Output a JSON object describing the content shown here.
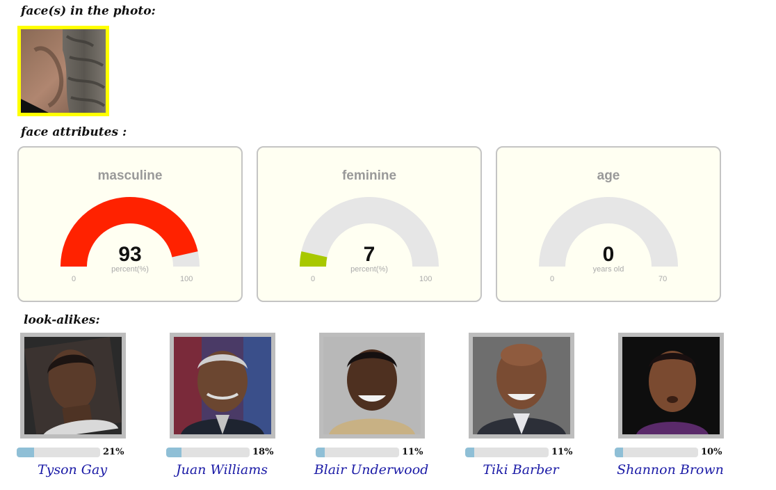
{
  "sections": {
    "faces_title": "face(s) in the photo:",
    "attributes_title": "face attributes :",
    "lookalikes_title": "look-alikes:"
  },
  "face_thumbnail": {
    "frame_color": "#ffff00"
  },
  "gauges": [
    {
      "title": "masculine",
      "value": 93,
      "value_text": "93",
      "unit": "percent(%)",
      "min": 0,
      "max": 100,
      "min_label": "0",
      "max_label": "100",
      "color": "#ff2200"
    },
    {
      "title": "feminine",
      "value": 7,
      "value_text": "7",
      "unit": "percent(%)",
      "min": 0,
      "max": 100,
      "min_label": "0",
      "max_label": "100",
      "color": "#a8c800"
    },
    {
      "title": "age",
      "value": 0,
      "value_text": "0",
      "unit": "years old",
      "min": 0,
      "max": 70,
      "min_label": "0",
      "max_label": "70",
      "color": "#a8c800"
    }
  ],
  "gauge_track_color": "#e6e6e6",
  "lookalikes": [
    {
      "name": "Tyson Gay",
      "percent": 21,
      "percent_label": "21%",
      "photo_icon": "portrait-photo"
    },
    {
      "name": "Juan Williams",
      "percent": 18,
      "percent_label": "18%",
      "photo_icon": "portrait-photo"
    },
    {
      "name": "Blair Underwood",
      "percent": 11,
      "percent_label": "11%",
      "photo_icon": "portrait-photo"
    },
    {
      "name": "Tiki Barber",
      "percent": 11,
      "percent_label": "11%",
      "photo_icon": "portrait-photo"
    },
    {
      "name": "Shannon Brown",
      "percent": 10,
      "percent_label": "10%",
      "photo_icon": "portrait-photo"
    }
  ],
  "similarity_bar_color": "#8fbfd6"
}
